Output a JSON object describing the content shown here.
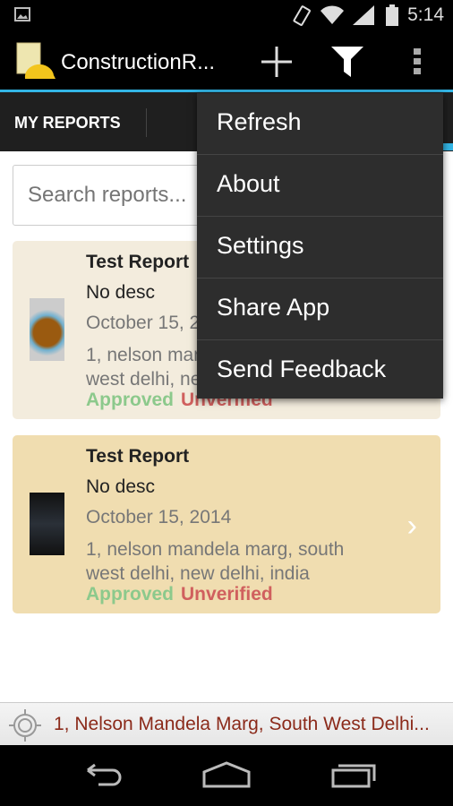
{
  "status_bar": {
    "time": "5:14",
    "icons": [
      "image-icon",
      "vibrate-icon",
      "wifi-icon",
      "signal-icon",
      "battery-icon"
    ]
  },
  "action_bar": {
    "title": "ConstructionR...",
    "actions": [
      "add-icon",
      "filter-icon",
      "overflow-icon"
    ]
  },
  "tabs": [
    {
      "label": "MY REPORTS"
    }
  ],
  "search": {
    "placeholder": "Search reports..."
  },
  "reports": [
    {
      "title": "Test Report",
      "description": "No desc",
      "date": "October 15, 2014",
      "address": "1, nelson mandela marg, south west delhi, new delhi, india",
      "status1": "Approved",
      "status2": "Unverified",
      "bg": "#f3ecdd"
    },
    {
      "title": "Test Report",
      "description": "No desc",
      "date": "October 15, 2014",
      "address": "1, nelson mandela marg, south west delhi, new delhi, india",
      "status1": "Approved",
      "status2": "Unverified",
      "bg": "#f0ddb0"
    }
  ],
  "menu": {
    "items": [
      "Refresh",
      "About",
      "Settings",
      "Share App",
      "Send Feedback"
    ]
  },
  "location_bar": {
    "text": "1, Nelson Mandela Marg, South West Delhi..."
  },
  "colors": {
    "accent": "#33b5e5",
    "approved": "#8cc98c",
    "unverified": "#d0605e",
    "location_text": "#8b2a1a"
  }
}
